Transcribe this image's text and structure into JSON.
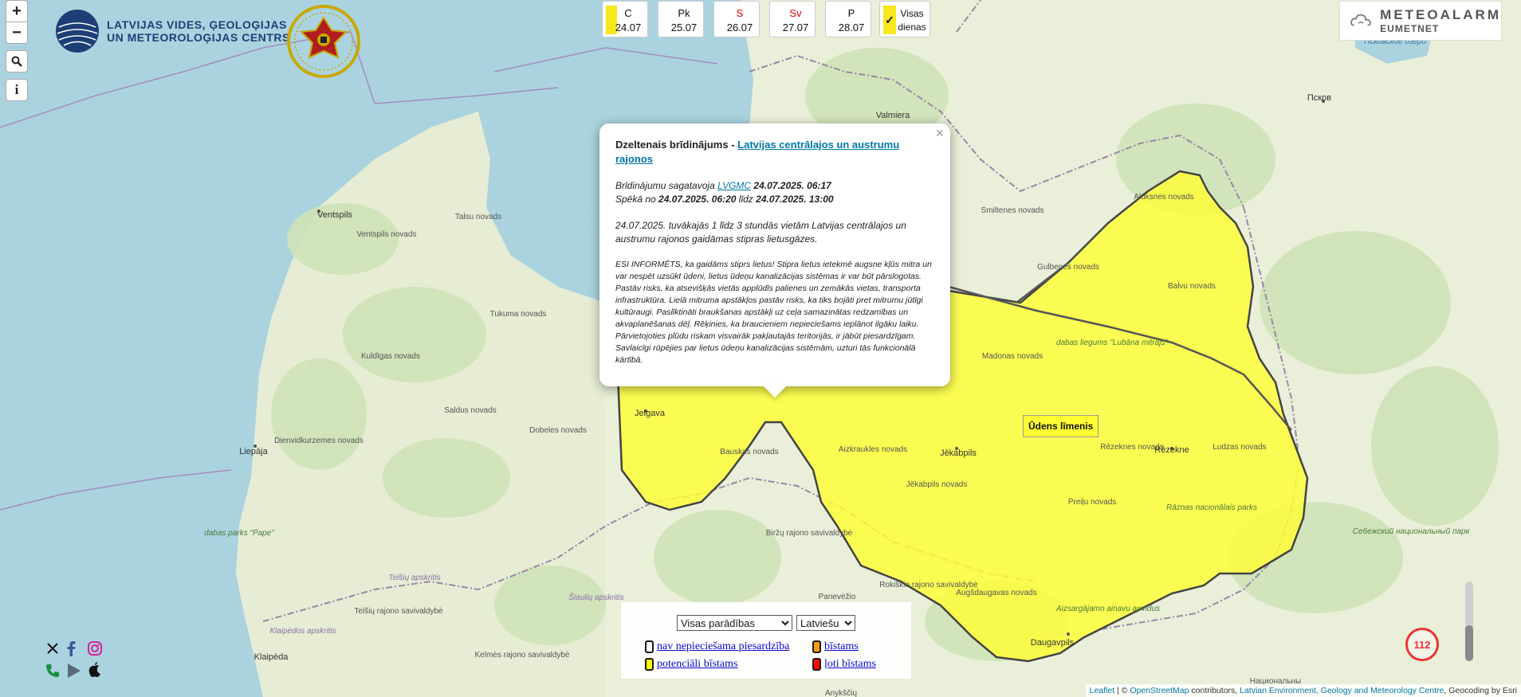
{
  "map": {
    "place_labels": [
      {
        "id": "ventspils",
        "text": "Ventspils"
      },
      {
        "id": "ventspils-novads",
        "text": "Ventspils novads"
      },
      {
        "id": "talsu-novads",
        "text": "Talsu novads"
      },
      {
        "id": "tukuma-novads",
        "text": "Tukuma novads"
      },
      {
        "id": "kuldigas-novads",
        "text": "Kuldīgas novads"
      },
      {
        "id": "saldus-novads",
        "text": "Saldus novads"
      },
      {
        "id": "dobeles-novads",
        "text": "Dobeles novads"
      },
      {
        "id": "dienvidkurzemes-novads",
        "text": "Dienvidkurzemes novads"
      },
      {
        "id": "liepaja",
        "text": "Liepāja"
      },
      {
        "id": "dabas-parks-pape",
        "text": "dabas parks \"Pape\""
      },
      {
        "id": "jelgava",
        "text": "Jelgava"
      },
      {
        "id": "bauskas-novads",
        "text": "Bauskas novads"
      },
      {
        "id": "aizkraukles-novads",
        "text": "Aizkraukles novads"
      },
      {
        "id": "jekabpils",
        "text": "Jēkabpils"
      },
      {
        "id": "jekabpils-novads",
        "text": "Jēkabpils novads"
      },
      {
        "id": "madonas-novads",
        "text": "Madonas novads"
      },
      {
        "id": "balvu-novads",
        "text": "Balvu novads"
      },
      {
        "id": "lubana",
        "text": "dabas liegums \"Lubāna mitrājs\""
      },
      {
        "id": "rezeknes-novads",
        "text": "Rēzeknes novads"
      },
      {
        "id": "rezekne",
        "text": "Rēzekne"
      },
      {
        "id": "ludzas-novads",
        "text": "Ludzas novads"
      },
      {
        "id": "preilu-novads",
        "text": "Preiļu novads"
      },
      {
        "id": "raznas",
        "text": "Rāznas nacionālais parks"
      },
      {
        "id": "augsdaugavas",
        "text": "Augšdaugavas novads"
      },
      {
        "id": "daugavpils",
        "text": "Daugavpils"
      },
      {
        "id": "aizsargajamo",
        "text": "Aizsargājamo ainavu apvidus"
      },
      {
        "id": "smiltenes-novads",
        "text": "Smiltenes novads"
      },
      {
        "id": "valmiera",
        "text": "Valmiera"
      },
      {
        "id": "aluksnes",
        "text": "Alūksnes novads"
      },
      {
        "id": "gulbenes",
        "text": "Gulbenes novads"
      },
      {
        "id": "pskov",
        "text": "Псков"
      },
      {
        "id": "pskov-lake",
        "text": "Псковское озеро"
      },
      {
        "id": "sebezh",
        "text": "Себежский национальный парк"
      },
      {
        "id": "birzu",
        "text": "Biržų rajono savivaldybė"
      },
      {
        "id": "panevezio",
        "text": "Panevėžio"
      },
      {
        "id": "rokiskio",
        "text": "Rokiškio rajono savivaldybė"
      },
      {
        "id": "siauliu",
        "text": "Šiaulių apskritis"
      },
      {
        "id": "telsiu",
        "text": "Telšių apskritis"
      },
      {
        "id": "telsiu-rajono",
        "text": "Telšių rajono savivaldybė"
      },
      {
        "id": "klaipedos",
        "text": "Klaipėdos apskritis"
      },
      {
        "id": "klaipeda",
        "text": "Klaipėda"
      },
      {
        "id": "kelmes",
        "text": "Kelmės rajono savivaldybė"
      },
      {
        "id": "anyksciu",
        "text": "Anykščių"
      },
      {
        "id": "nacionalnyj",
        "text": "Национальны"
      }
    ]
  },
  "logos": {
    "lvgmc_line1": "LATVIJAS VIDES, ĢEOLOĢIJAS",
    "lvgmc_line2": "UN METEOROLOĢIJAS CENTRS"
  },
  "days": [
    {
      "label": "C",
      "date": "24.07",
      "red": false
    },
    {
      "label": "Pk",
      "date": "25.07",
      "red": false
    },
    {
      "label": "S",
      "date": "26.07",
      "red": true
    },
    {
      "label": "Sv",
      "date": "27.07",
      "red": true
    },
    {
      "label": "P",
      "date": "28.07",
      "red": false
    }
  ],
  "all_days": {
    "line1": "Visas",
    "line2": "dienas",
    "check": "✓"
  },
  "meteoalarm": {
    "line1": "METEOALARM",
    "line2": "EUMETNET"
  },
  "popup": {
    "close": "×",
    "title_prefix": "Dzeltenais brīdinājums - ",
    "title_link": "Latvijas centrālajos un austrumu rajonos",
    "prepared_prefix": "Brīdinājumu sagatavoja ",
    "prepared_link": "LVGMC",
    "prepared_time": " 24.07.2025. 06:17",
    "valid_prefix": "Spēkā no ",
    "valid_from": "24.07.2025. 06:20",
    "valid_mid": " līdz ",
    "valid_to": "24.07.2025. 13:00",
    "description": "24.07.2025. tuvākajās 1 līdz 3 stundās vietām Latvijas centrālajos un austrumu rajonos gaidāmas stipras lietusgāzes.",
    "info": "ESI INFORMĒTS, ka gaidāms stiprs lietus! Stipra lietus ietekmē augsne kļūs mitra un var nespēt uzsūkt ūdeni, lietus ūdeņu kanalizācijas sistēmas ir var būt pārslogotas. Pastāv risks, ka atsevišķās vietās applūdīs palienes un zemākās vietas, transporta infrastruktūra. Lielā mitruma apstākļos pastāv risks, ka tiks bojāti pret mitrumu jūtīgi kultūraugi. Paslīktināti braukšanas apstākļi uz ceļa samazinātas redzamības un akvaplanēšanas dēļ. Rēķinies, ka braucieniem nepieciešams ieplānot ilgāku laiku. Pārvietojoties plūdu riskam visvairāk pakļautajās teritorijās, ir jābūt piesardzīgam. Savlaicīgi rūpējies par lietus ūdeņu kanalizācijas sistēmām, uzturi tās funkcionālā kārtībā."
  },
  "warning_label": "Ūdens līmenis",
  "legend": {
    "select_events": "Visas parādības",
    "select_lang": "Latviešu",
    "items": [
      {
        "text": "nav nepieciešama piesardzība",
        "color": "#ffffff"
      },
      {
        "text": "bīstams",
        "color": "#ff9900"
      },
      {
        "text": "potenciāli bīstams",
        "color": "#ffff00"
      },
      {
        "text": "ļoti bīstams",
        "color": "#ff0000"
      }
    ]
  },
  "sos": "112",
  "attribution": {
    "leaflet": "Leaflet",
    "sep1": " | © ",
    "osm": "OpenStreetMap",
    "mid": " contributors, ",
    "lvgmc": "Latvian Environment, Geology and Meteorology Centre",
    "end": ", Geocoding by Esri"
  },
  "colors": {
    "sea": "#aad3df",
    "land": "#e9efd8",
    "forest": "#c9ddb0",
    "warning_yellow": "#ffff33",
    "border": "#9a86a8",
    "link": "#0078a8"
  }
}
